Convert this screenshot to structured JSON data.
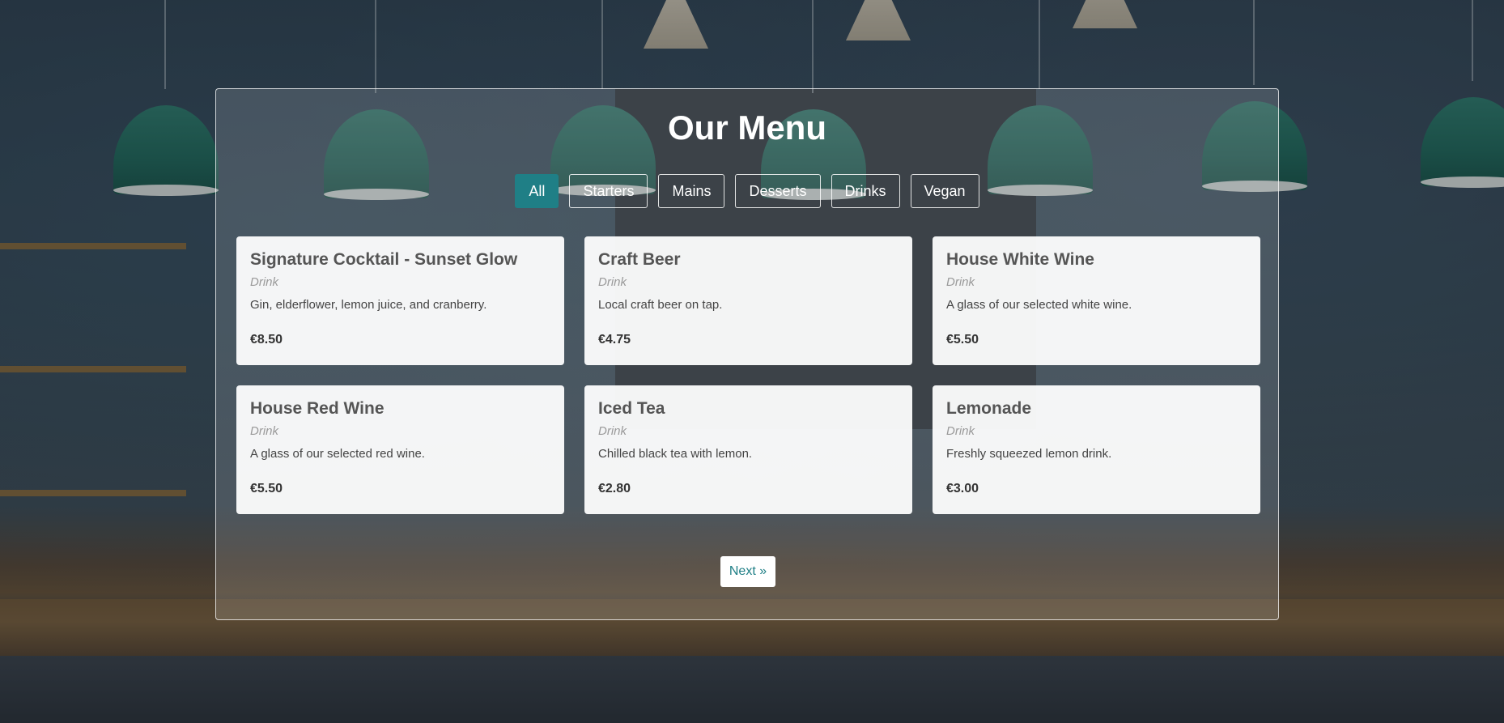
{
  "menu": {
    "title": "Our Menu",
    "filters": [
      {
        "label": "All",
        "active": true
      },
      {
        "label": "Starters",
        "active": false
      },
      {
        "label": "Mains",
        "active": false
      },
      {
        "label": "Desserts",
        "active": false
      },
      {
        "label": "Drinks",
        "active": false
      },
      {
        "label": "Vegan",
        "active": false
      }
    ],
    "items": [
      {
        "name": "Signature Cocktail - Sunset Glow",
        "category": "Drink",
        "description": "Gin, elderflower, lemon juice, and cranberry.",
        "price": "€8.50"
      },
      {
        "name": "Craft Beer",
        "category": "Drink",
        "description": "Local craft beer on tap.",
        "price": "€4.75"
      },
      {
        "name": "House White Wine",
        "category": "Drink",
        "description": "A glass of our selected white wine.",
        "price": "€5.50"
      },
      {
        "name": "House Red Wine",
        "category": "Drink",
        "description": "A glass of our selected red wine.",
        "price": "€5.50"
      },
      {
        "name": "Iced Tea",
        "category": "Drink",
        "description": "Chilled black tea with lemon.",
        "price": "€2.80"
      },
      {
        "name": "Lemonade",
        "category": "Drink",
        "description": "Freshly squeezed lemon drink.",
        "price": "€3.00"
      }
    ],
    "pagination": {
      "next_label": "Next »"
    }
  },
  "colors": {
    "accent": "#1f7f86",
    "card_background": "#ffffff",
    "title_text": "#ffffff"
  }
}
